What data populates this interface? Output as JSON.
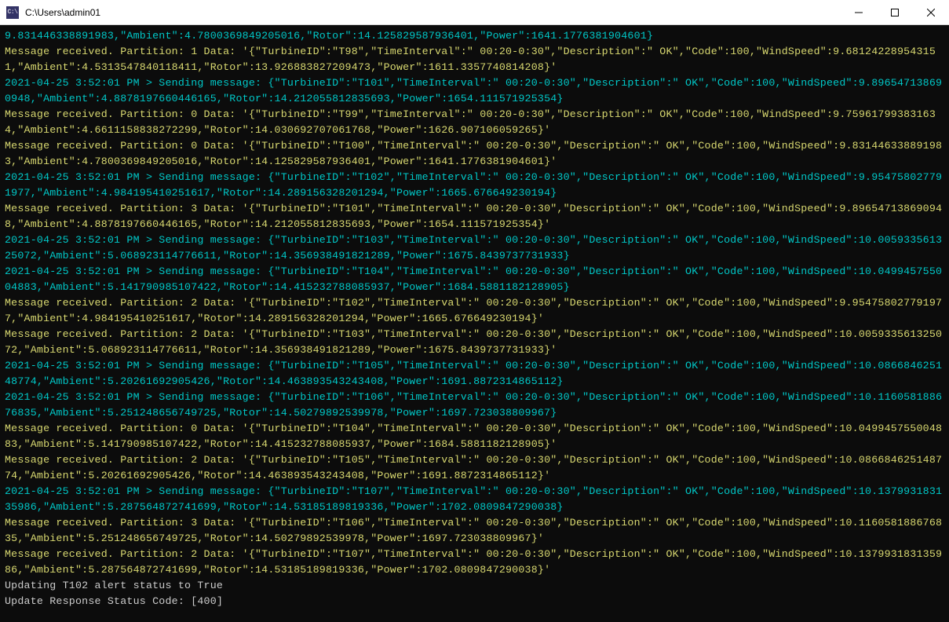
{
  "window": {
    "title": "C:\\Users\\admin01",
    "icon_label": "C:\\"
  },
  "terminal_segments": [
    {
      "c": "cyan",
      "t": "9.831446338891983,\"Ambient\":4.7800369849205016,\"Rotor\":14.125829587936401,\"Power\":1641.1776381904601}\n"
    },
    {
      "c": "yellow",
      "t": "Message received. Partition: 1 Data: '{\"TurbineID\":\"T98\",\"TimeInterval\":\" 00:20-0:30\",\"Description\":\" OK\",\"Code\":100,\"WindSpeed\":9.681242289543151,\"Ambient\":4.5313547840118411,\"Rotor\":13.926883827209473,\"Power\":1611.3357740814208}'\n"
    },
    {
      "c": "cyan",
      "t": "2021-04-25 3:52:01 PM > Sending message: {\"TurbineID\":\"T101\",\"TimeInterval\":\" 00:20-0:30\",\"Description\":\" OK\",\"Code\":100,\"WindSpeed\":9.896547138690948,\"Ambient\":4.8878197660446165,\"Rotor\":14.212055812835693,\"Power\":1654.111571925354}\n"
    },
    {
      "c": "yellow",
      "t": "Message received. Partition: 0 Data: '{\"TurbineID\":\"T99\",\"TimeInterval\":\" 00:20-0:30\",\"Description\":\" OK\",\"Code\":100,\"WindSpeed\":9.759617993831634,\"Ambient\":4.6611158838272299,\"Rotor\":14.030692707061768,\"Power\":1626.907106059265}'\n"
    },
    {
      "c": "yellow",
      "t": "Message received. Partition: 0 Data: '{\"TurbineID\":\"T100\",\"TimeInterval\":\" 00:20-0:30\",\"Description\":\" OK\",\"Code\":100,\"WindSpeed\":9.831446338891983,\"Ambient\":4.7800369849205016,\"Rotor\":14.125829587936401,\"Power\":1641.1776381904601}'\n"
    },
    {
      "c": "cyan",
      "t": "2021-04-25 3:52:01 PM > Sending message: {\"TurbineID\":\"T102\",\"TimeInterval\":\" 00:20-0:30\",\"Description\":\" OK\",\"Code\":100,\"WindSpeed\":9.954758027791977,\"Ambient\":4.984195410251617,\"Rotor\":14.289156328201294,\"Power\":1665.676649230194}\n"
    },
    {
      "c": "yellow",
      "t": "Message received. Partition: 3 Data: '{\"TurbineID\":\"T101\",\"TimeInterval\":\" 00:20-0:30\",\"Description\":\" OK\",\"Code\":100,\"WindSpeed\":9.896547138690948,\"Ambient\":4.8878197660446165,\"Rotor\":14.212055812835693,\"Power\":1654.111571925354}'\n"
    },
    {
      "c": "cyan",
      "t": "2021-04-25 3:52:01 PM > Sending message: {\"TurbineID\":\"T103\",\"TimeInterval\":\" 00:20-0:30\",\"Description\":\" OK\",\"Code\":100,\"WindSpeed\":10.005933561325072,\"Ambient\":5.068923114776611,\"Rotor\":14.356938491821289,\"Power\":1675.8439737731933}\n"
    },
    {
      "c": "cyan",
      "t": "2021-04-25 3:52:01 PM > Sending message: {\"TurbineID\":\"T104\",\"TimeInterval\":\" 00:20-0:30\",\"Description\":\" OK\",\"Code\":100,\"WindSpeed\":10.049945755004883,\"Ambient\":5.141790985107422,\"Rotor\":14.415232788085937,\"Power\":1684.5881182128905}\n"
    },
    {
      "c": "yellow",
      "t": "Message received. Partition: 2 Data: '{\"TurbineID\":\"T102\",\"TimeInterval\":\" 00:20-0:30\",\"Description\":\" OK\",\"Code\":100,\"WindSpeed\":9.954758027791977,\"Ambient\":4.984195410251617,\"Rotor\":14.289156328201294,\"Power\":1665.676649230194}'\n"
    },
    {
      "c": "yellow",
      "t": "Message received. Partition: 2 Data: '{\"TurbineID\":\"T103\",\"TimeInterval\":\" 00:20-0:30\",\"Description\":\" OK\",\"Code\":100,\"WindSpeed\":10.005933561325072,\"Ambient\":5.068923114776611,\"Rotor\":14.356938491821289,\"Power\":1675.8439737731933}'\n"
    },
    {
      "c": "cyan",
      "t": "2021-04-25 3:52:01 PM > Sending message: {\"TurbineID\":\"T105\",\"TimeInterval\":\" 00:20-0:30\",\"Description\":\" OK\",\"Code\":100,\"WindSpeed\":10.086684625148774,\"Ambient\":5.20261692905426,\"Rotor\":14.463893543243408,\"Power\":1691.8872314865112}\n"
    },
    {
      "c": "cyan",
      "t": "2021-04-25 3:52:01 PM > Sending message: {\"TurbineID\":\"T106\",\"TimeInterval\":\" 00:20-0:30\",\"Description\":\" OK\",\"Code\":100,\"WindSpeed\":10.116058188676835,\"Ambient\":5.251248656749725,\"Rotor\":14.50279892539978,\"Power\":1697.723038809967}\n"
    },
    {
      "c": "yellow",
      "t": "Message received. Partition: 0 Data: '{\"TurbineID\":\"T104\",\"TimeInterval\":\" 00:20-0:30\",\"Description\":\" OK\",\"Code\":100,\"WindSpeed\":10.049945755004883,\"Ambient\":5.141790985107422,\"Rotor\":14.415232788085937,\"Power\":1684.5881182128905}'\n"
    },
    {
      "c": "yellow",
      "t": "Message received. Partition: 2 Data: '{\"TurbineID\":\"T105\",\"TimeInterval\":\" 00:20-0:30\",\"Description\":\" OK\",\"Code\":100,\"WindSpeed\":10.086684625148774,\"Ambient\":5.20261692905426,\"Rotor\":14.463893543243408,\"Power\":1691.8872314865112}'\n"
    },
    {
      "c": "cyan",
      "t": "2021-04-25 3:52:01 PM > Sending message: {\"TurbineID\":\"T107\",\"TimeInterval\":\" 00:20-0:30\",\"Description\":\" OK\",\"Code\":100,\"WindSpeed\":10.137993183135986,\"Ambient\":5.287564872741699,\"Rotor\":14.53185189819336,\"Power\":1702.0809847290038}\n"
    },
    {
      "c": "yellow",
      "t": "Message received. Partition: 3 Data: '{\"TurbineID\":\"T106\",\"TimeInterval\":\" 00:20-0:30\",\"Description\":\" OK\",\"Code\":100,\"WindSpeed\":10.116058188676835,\"Ambient\":5.251248656749725,\"Rotor\":14.50279892539978,\"Power\":1697.723038809967}'\n"
    },
    {
      "c": "yellow",
      "t": "Message received. Partition: 2 Data: '{\"TurbineID\":\"T107\",\"TimeInterval\":\" 00:20-0:30\",\"Description\":\" OK\",\"Code\":100,\"WindSpeed\":10.137993183135986,\"Ambient\":5.287564872741699,\"Rotor\":14.53185189819336,\"Power\":1702.0809847290038}'\n"
    },
    {
      "c": "white",
      "t": "Updating T102 alert status to True\n"
    },
    {
      "c": "white",
      "t": "Update Response Status Code: [400]\n"
    }
  ]
}
